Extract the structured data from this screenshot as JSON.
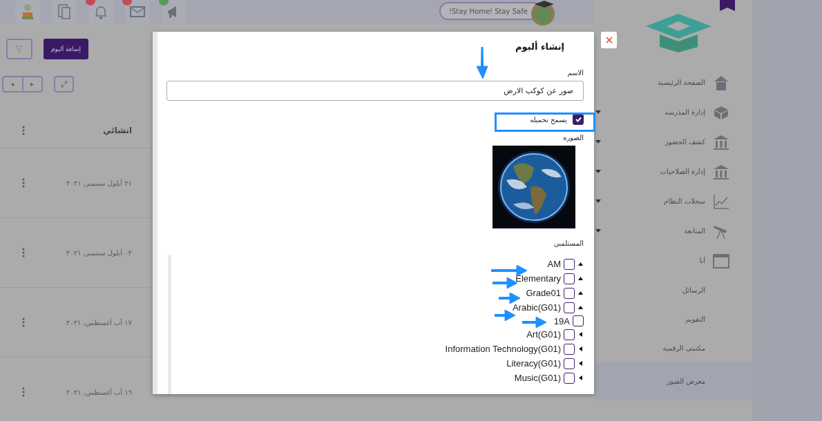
{
  "topbar": {
    "slogan": "!Stay Home! Stay Safe"
  },
  "toolbar": {
    "add_button": "إضافة ألبوم"
  },
  "table": {
    "header": "انشائي",
    "rows": [
      "٢١ أيلول سبتمبر, ٢٠٢١",
      "٠٢ أيلول سبتمبر, ٢٠٢١",
      "١٧ آب أغسطس, ٢٠٢١",
      "١٦ آب أغسطس, ٢٠٢١"
    ]
  },
  "sidebar": {
    "items": [
      {
        "label": "الصفحة الرئيسية",
        "kind": "home",
        "has_menu": false,
        "selected": false
      },
      {
        "label": "إدارة المدرسة",
        "kind": "box",
        "has_menu": true,
        "selected": false
      },
      {
        "label": "كشف الحضور",
        "kind": "building",
        "has_menu": true,
        "selected": false
      },
      {
        "label": "إدارة الصلاحيات",
        "kind": "building",
        "has_menu": true,
        "selected": false
      },
      {
        "label": "سجلات النظام",
        "kind": "chart",
        "has_menu": true,
        "selected": false
      },
      {
        "label": "المتابعة",
        "kind": "telescope",
        "has_menu": true,
        "selected": false
      },
      {
        "label": "أنا",
        "kind": "calendar",
        "has_menu": false,
        "selected": false
      },
      {
        "label": "الرسائل",
        "has_menu": false,
        "selected": false
      },
      {
        "label": "التقويم",
        "has_menu": false,
        "selected": false
      },
      {
        "label": "مكتبتي الرقمية",
        "has_menu": false,
        "selected": false
      },
      {
        "label": "معرض الصور",
        "has_menu": false,
        "selected": true
      }
    ]
  },
  "dialog": {
    "title": "إنشاء ألبوم",
    "name_label": "الاسم",
    "name_value": "صور عن كوكب الارض",
    "allow_download": {
      "label": "يسمح تحميله",
      "checked": true
    },
    "image_label": "الصوره",
    "recipients_label": "المستلمين",
    "recipients": [
      {
        "label": "AM",
        "checked": false,
        "expanded": true,
        "children": [
          {
            "label": "Elementary",
            "checked": false,
            "expanded": true,
            "children": [
              {
                "label": "Grade01",
                "checked": false,
                "expanded": true,
                "children": [
                  {
                    "label": "Arabic(G01)",
                    "checked": false,
                    "expanded": true,
                    "children": [
                      {
                        "label": "19A",
                        "checked": false
                      }
                    ]
                  },
                  {
                    "label": "Art(G01)",
                    "checked": false,
                    "expanded": false
                  },
                  {
                    "label": "Information Technology(G01)",
                    "checked": false,
                    "expanded": false
                  },
                  {
                    "label": "Literacy(G01)",
                    "checked": false,
                    "expanded": false
                  },
                  {
                    "label": "Music(G01)",
                    "checked": false,
                    "expanded": false
                  }
                ]
              }
            ]
          }
        ]
      }
    ]
  }
}
